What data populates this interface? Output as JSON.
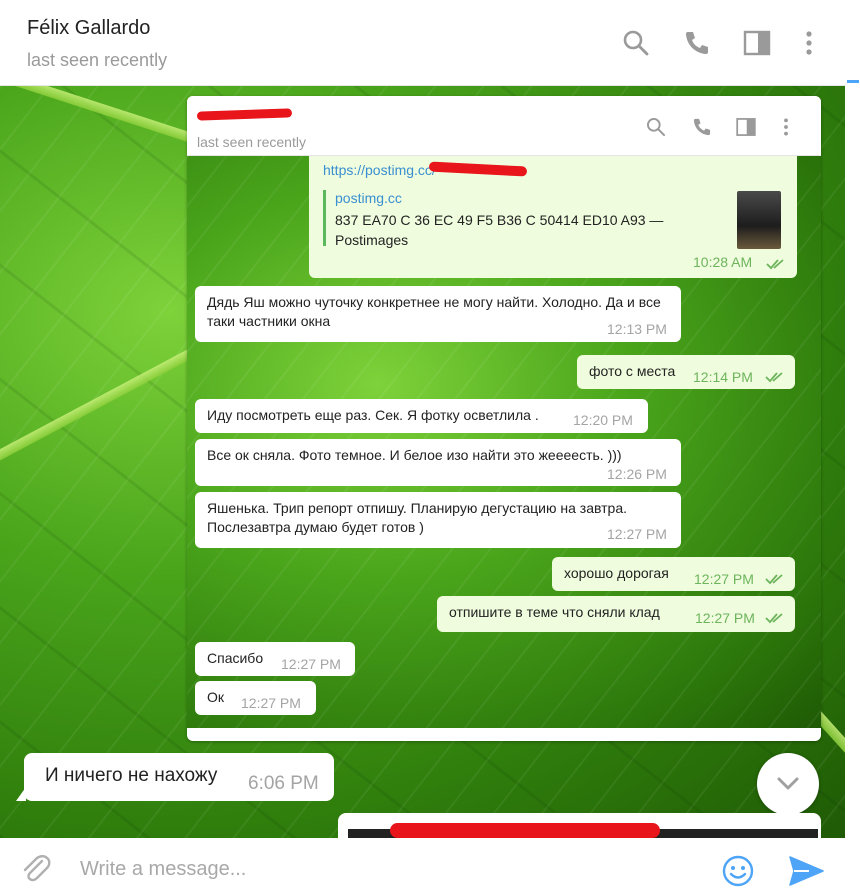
{
  "header": {
    "title": "Félix Gallardo",
    "status": "last seen recently"
  },
  "inner": {
    "status": "last seen recently",
    "link": {
      "url": "https://postimg.cc/",
      "site": "postimg.cc",
      "text": "837 EA70 C 36 EC 49 F5 B36 C 50414 ED10 A93 — Postimages",
      "time": "10:28 AM"
    },
    "messages": [
      {
        "dir": "in",
        "text": "Дядь Яш можно чуточку конкретнее не могу найти. Холодно. Да и все таки частники окна",
        "time": "12:13 PM"
      },
      {
        "dir": "out",
        "text": "фото с места",
        "time": "12:14 PM"
      },
      {
        "dir": "in",
        "text": "Иду посмотреть еще раз. Сек. Я фотку осветлила .",
        "time": "12:20 PM"
      },
      {
        "dir": "in",
        "text": "Все ок сняла. Фото темное. И белое изо найти это жееeесть. )))",
        "time": "12:26 PM"
      },
      {
        "dir": "in",
        "text": "Яшенька. Трип репорт отпишу. Планирую дегустацию на завтра. Послезавтра думаю будет готов )",
        "time": "12:27 PM"
      },
      {
        "dir": "out",
        "text": "хорошо дорогая",
        "time": "12:27 PM"
      },
      {
        "dir": "out",
        "text": "отпишите в теме что сняли клад",
        "time": "12:27 PM"
      },
      {
        "dir": "in",
        "text": "Спасибо",
        "time": "12:27 PM"
      },
      {
        "dir": "in",
        "text": "Ок",
        "time": "12:27 PM"
      }
    ]
  },
  "outer_message": {
    "text": "И ничего не нахожу",
    "time": "6:06 PM"
  },
  "composer": {
    "placeholder": "Write a message..."
  },
  "icons": {
    "header": [
      "search-icon",
      "phone-icon",
      "sidebar-toggle-icon",
      "more-vertical-icon"
    ],
    "composer": [
      "attach-icon",
      "emoji-icon",
      "send-icon"
    ],
    "scroll": "chevron-down-icon"
  },
  "colors": {
    "accent": "#4ea4f6",
    "outgoing_bubble": "#effdde",
    "incoming_bubble": "#ffffff",
    "send_icon": "#4ea4f6"
  }
}
